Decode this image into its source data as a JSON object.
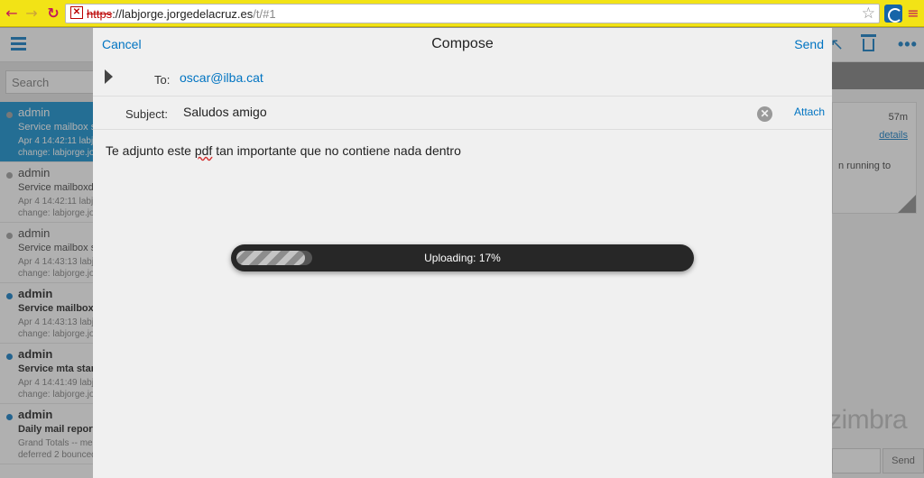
{
  "browser": {
    "url_scheme": "https",
    "url_host": "://labjorge.jorgedelacruz.es",
    "url_path": "/t/#1",
    "icons": [
      "back-arrow-icon",
      "forward-arrow-icon",
      "reload-icon",
      "bookmark-star-icon",
      "extension-icon",
      "chrome-menu-icon"
    ]
  },
  "app": {
    "search_placeholder": "Search",
    "messages": [
      {
        "from": "admin",
        "subject": "Service mailbox s",
        "meta1": "Apr 4 14:42:11 labj",
        "meta2": "change: labjorge.jo",
        "unread": false,
        "selected": true
      },
      {
        "from": "admin",
        "subject": "Service mailboxd",
        "meta1": "Apr 4 14:42:11 labj",
        "meta2": "change: labjorge.jo",
        "unread": false,
        "selected": false
      },
      {
        "from": "admin",
        "subject": "Service mailbox s",
        "meta1": "Apr 4 14:43:13 labj",
        "meta2": "change: labjorge.jo",
        "unread": false,
        "selected": false
      },
      {
        "from": "admin",
        "subject": "Service mailbox",
        "meta1": "Apr 4 14:43:13 labj",
        "meta2": "change: labjorge.jo",
        "unread": true,
        "selected": false
      },
      {
        "from": "admin",
        "subject": "Service mta star",
        "meta1": "Apr 4 14:41:49 labj",
        "meta2": "change: labjorge.jo",
        "unread": true,
        "selected": false
      },
      {
        "from": "admin",
        "subject": "Daily mail report",
        "meta1": "Grand Totals -- mes",
        "meta2": "deferred 2 bounced",
        "unread": true,
        "selected": false
      }
    ],
    "conversation": {
      "time": "57m",
      "details_link": "details",
      "body_fragment": "n running to"
    },
    "logo": "zimbra",
    "quick_send": "Send"
  },
  "compose": {
    "cancel": "Cancel",
    "title": "Compose",
    "send": "Send",
    "to_label": "To:",
    "to_value": "oscar@ilba.cat",
    "subject_label": "Subject:",
    "subject_value": "Saludos amigo",
    "attach": "Attach",
    "body_before": "Te adjunto este ",
    "body_misspelled": "pdf",
    "body_after": " tan importante que no contiene nada dentro"
  },
  "upload": {
    "label": "Uploading: 17%",
    "progress": 0.17
  },
  "colors": {
    "accent": "#0074c2",
    "selected_row": "#0088cc",
    "browser_bar": "#f2e316"
  }
}
